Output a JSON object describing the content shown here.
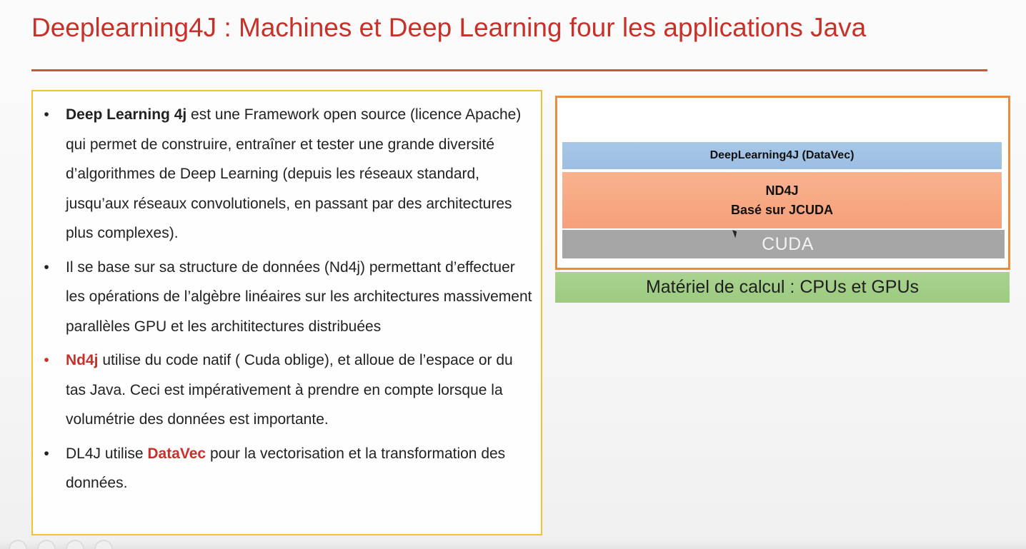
{
  "slide": {
    "title": "Deeplearning4J : Machines et Deep Learning four les applications Java",
    "bullets": [
      {
        "strong": "Deep Learning 4j",
        "text": " est une Framework open source (licence Apache) qui permet de construire, entraîner et tester une grande diversité d’algorithmes de Deep Learning (depuis les réseaux standard, jusqu’aux réseaux convolutionels, en passant par des architectures plus complexes)."
      },
      {
        "text": "Il se base sur sa structure de données (Nd4j) permettant d’effectuer les opérations de l’algèbre linéaires sur les architectures massivement parallèles GPU et les archititectures distribuées"
      },
      {
        "strong": "Nd4j",
        "text": " utilise du code natif ( Cuda oblige), et alloue de l’espace or du tas Java. Ceci est impérativement à prendre en compte lorsque la volumétrie des données est importante."
      },
      {
        "prefix": "DL4J utilise ",
        "strong": "DataVec",
        "text": " pour la vectorisation et la transformation des données."
      }
    ],
    "stack": {
      "dl4j_layer": "DeepLearning4J (DataVec)",
      "nd4j_line1": "ND4J",
      "nd4j_line2": "Basé sur JCUDA",
      "cuda_layer": "CUDA",
      "hardware": "Matériel de calcul  : CPUs et GPUs"
    },
    "colors": {
      "title": "#c8302a",
      "accent_red": "#c8302a",
      "textbox_border": "#f2c230",
      "stack_border": "#ee8a3c",
      "dl4j_layer": "#a7c7e8",
      "nd4j_layer": "#f7a985",
      "cuda_layer": "#a6a6a6",
      "hardware_layer": "#a3cf88"
    }
  }
}
